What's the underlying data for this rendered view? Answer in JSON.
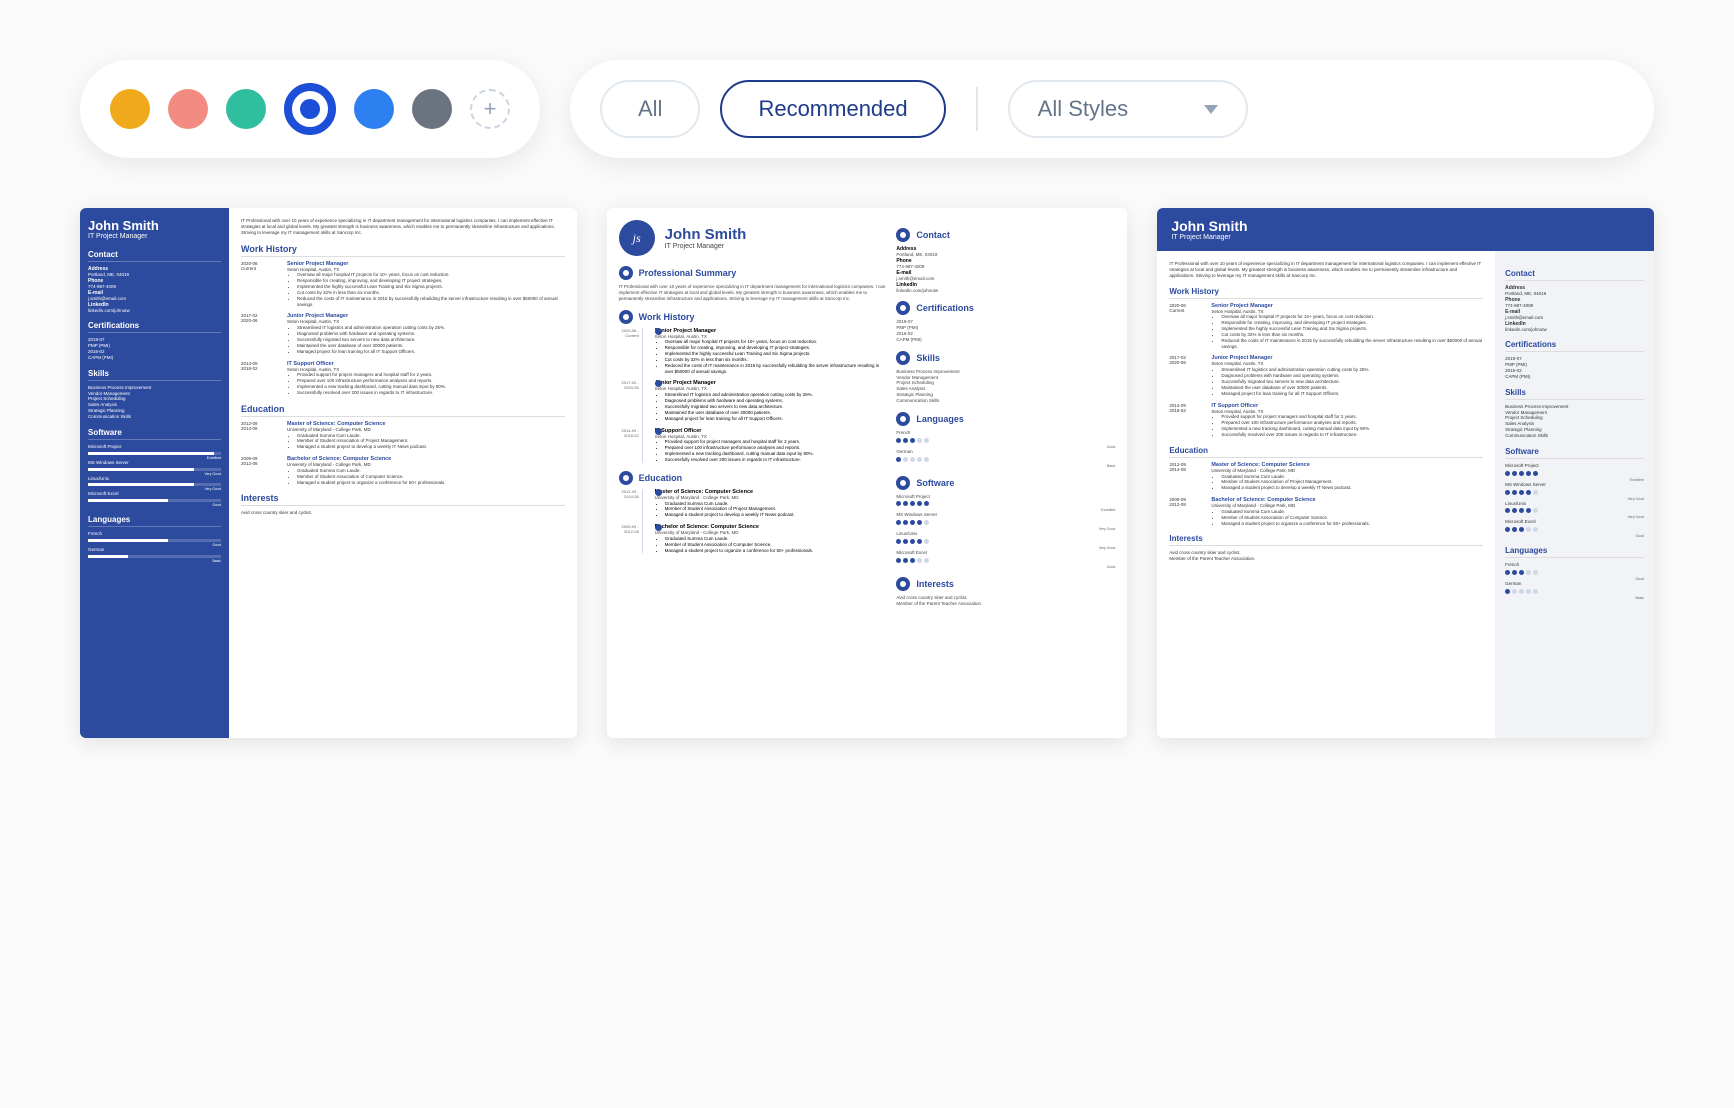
{
  "palette": {
    "colors": [
      "#f1a91c",
      "#f28b82",
      "#2fbf9e",
      "#1d4ed8",
      "#2e7ff0",
      "#6b7280"
    ],
    "selected_index": 3,
    "add_label": "+"
  },
  "filters": {
    "all": "All",
    "recommended": "Recommended",
    "dropdown_label": "All Styles"
  },
  "resume": {
    "name": "John Smith",
    "title": "IT Project Manager",
    "initials": "js",
    "summary": "IT Professional with over 10 years of experience specializing in IT department management for international logistics companies. I can implement effective IT strategies at local and global levels. My greatest strength is business awareness, which enables me to permanently streamline infrastructure and applications. Striving to leverage my IT management skills at Sancorp Inc.",
    "sections": {
      "contact": "Contact",
      "certifications": "Certifications",
      "skills": "Skills",
      "software": "Software",
      "languages": "Languages",
      "work_history": "Work History",
      "education": "Education",
      "interests": "Interests",
      "prof_summary": "Professional Summary"
    },
    "contact": {
      "address_l": "Address",
      "address": "Portland, ME, 04019",
      "phone_l": "Phone",
      "phone": "774-987-4009",
      "email_l": "E-mail",
      "email": "j.smith@email.com",
      "linkedin_l": "LinkedIn",
      "linkedin": "linkedin.com/johnutw"
    },
    "certifications": [
      {
        "date": "2019-07",
        "name": "PMP (PMI)"
      },
      {
        "date": "2016-02",
        "name": "CAPM (PMI)"
      }
    ],
    "skills": [
      "Business Process Improvement",
      "Vendor Management",
      "Project Scheduling",
      "Sales Analysis",
      "Strategic Planning",
      "Communication Skills"
    ],
    "software": [
      {
        "name": "Microsoft Project",
        "level": "Excellent",
        "fill": 95,
        "dots": 5
      },
      {
        "name": "MS Windows Server",
        "level": "Very Good",
        "fill": 80,
        "dots": 4
      },
      {
        "name": "Linux/Unix",
        "level": "Very Good",
        "fill": 80,
        "dots": 4
      },
      {
        "name": "Microsoft Excel",
        "level": "Good",
        "fill": 60,
        "dots": 3
      }
    ],
    "languages": [
      {
        "name": "French",
        "level": "Good",
        "fill": 60,
        "dots": 3
      },
      {
        "name": "German",
        "level": "Basic",
        "fill": 30,
        "dots": 1
      }
    ],
    "work": [
      {
        "date": "2020-06 - Current",
        "title": "Senior Project Manager",
        "org": "Seton Hospital, Austin, TX",
        "bullets": [
          "Oversaw all major hospital IT projects for 10+ years, focus on cost reduction.",
          "Responsible for creating, improving, and developing IT project strategies.",
          "Implemented the highly successful Lean Training and Six Sigma projects.",
          "Cut costs by 32% in less than six months.",
          "Reduced the costs of IT maintenance in 2015 by successfully rebuilding the server infrastructure resulting in over $50000 of annual savings."
        ]
      },
      {
        "date": "2017-02 - 2020-06",
        "title": "Junior Project Manager",
        "org": "Seton Hospital, Austin, TX",
        "bullets": [
          "Streamlined IT logistics and administration operation cutting costs by 25%.",
          "Diagnosed problems with hardware and operating systems.",
          "Successfully migrated two servers to new data architecture.",
          "Maintained the user database of over 30000 patients.",
          "Managed project for lean training for all IT Support Officers."
        ]
      },
      {
        "date": "2014-09 - 2018-02",
        "title": "IT Support Officer",
        "org": "Seton Hospital, Austin, TX",
        "bullets": [
          "Provided support for project managers and hospital staff for 2 years.",
          "Prepared over 100 infrastructure performance analyses and reports.",
          "Implemented a new tracking dashboard, cutting manual data input by 80%.",
          "Successfully resolved over 200 issues in regards to IT infrastructure."
        ]
      }
    ],
    "education": [
      {
        "date": "2012-09 - 2014-08",
        "title": "Master of Science: Computer Science",
        "org": "University of Maryland - College Park, MD",
        "bullets": [
          "Graduated Summa Cum Laude.",
          "Member of Student Association of Project Management.",
          "Managed a student project to develop a weekly IT News podcast."
        ]
      },
      {
        "date": "2009-09 - 2012-08",
        "title": "Bachelor of Science: Computer Science",
        "org": "University of Maryland - College Park, MD",
        "bullets": [
          "Graduated Summa Cum Laude.",
          "Member of Student Association of Computer Science.",
          "Managed a student project to organize a conference for 50+ professionals."
        ]
      }
    ],
    "interests": [
      "Avid cross country skier and cyclist.",
      "Member of the Parent Teacher Association."
    ]
  }
}
